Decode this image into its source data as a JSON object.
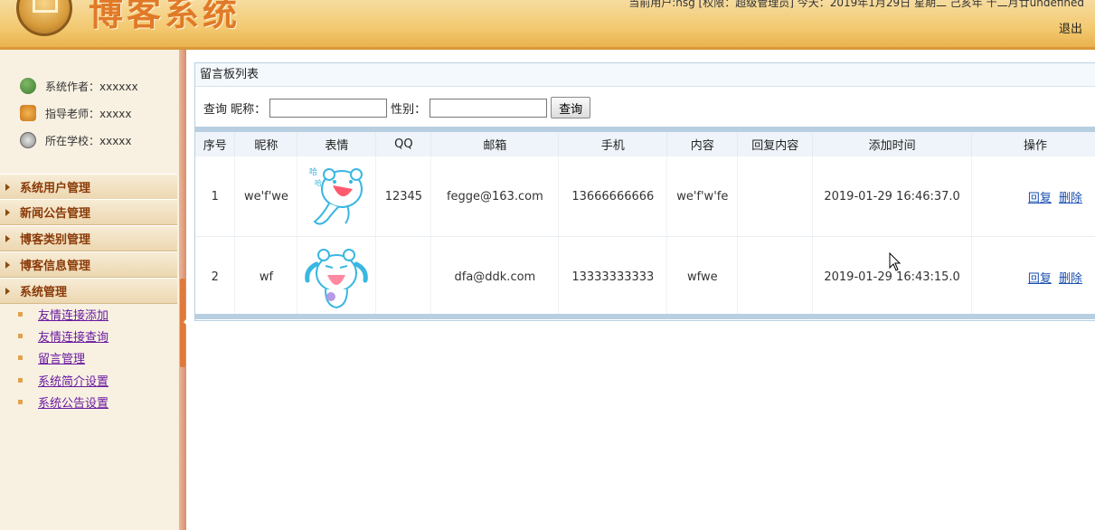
{
  "header": {
    "app_title": "博客系统",
    "user_info": "当前用户:hsg [权限：超级管理员] 今天：2019年1月29日 星期二 己亥年 十二月廿undefined",
    "logout": "退出"
  },
  "sidebar": {
    "info": [
      {
        "label": "系统作者：xxxxxx",
        "icon": "author-icon"
      },
      {
        "label": "指导老师：xxxxx",
        "icon": "teacher-icon"
      },
      {
        "label": "所在学校：xxxxx",
        "icon": "school-icon"
      }
    ],
    "menus": [
      "系统用户管理",
      "新闻公告管理",
      "博客类别管理",
      "博客信息管理",
      "系统管理"
    ],
    "submenu": [
      "友情连接添加",
      "友情连接查询",
      "留言管理",
      "系统简介设置",
      "系统公告设置"
    ]
  },
  "main": {
    "panel_title": "留言板列表",
    "search": {
      "nickname_label": "查询 昵称：",
      "nickname_value": "",
      "gender_label": "性别：",
      "gender_value": "",
      "button": "查询"
    },
    "table": {
      "columns": [
        "序号",
        "昵称",
        "表情",
        "QQ",
        "邮箱",
        "手机",
        "内容",
        "回复内容",
        "添加时间",
        "操作"
      ],
      "rows": [
        {
          "no": "1",
          "nickname": "we'f'we",
          "emoticon": "cartoon-bear-laughing",
          "qq": "12345",
          "email": "fegge@163.com",
          "phone": "13666666666",
          "content": "we'f'w'fe",
          "reply": "",
          "time": "2019-01-29 16:46:37.0",
          "reply_link": "回复",
          "delete_link": "删除"
        },
        {
          "no": "2",
          "nickname": "wf",
          "emoticon": "cartoon-bear-crying",
          "qq": "",
          "email": "dfa@ddk.com",
          "phone": "13333333333",
          "content": "wfwe",
          "reply": "",
          "time": "2019-01-29 16:43:15.0",
          "reply_link": "回复",
          "delete_link": "删除"
        }
      ]
    }
  },
  "colors": {
    "header_bg": "#f3c970",
    "title_orange": "#e07a28",
    "menu_text": "#8a3a08",
    "link_purple": "#6a1aa0",
    "link_blue": "#1a4fb0",
    "table_bar": "#b8cfe2"
  }
}
